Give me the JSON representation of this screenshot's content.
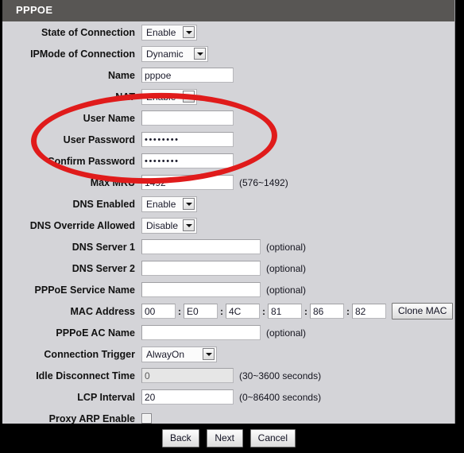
{
  "window": {
    "title": "PPPOE"
  },
  "form": {
    "rows": [
      {
        "label": "State of Connection",
        "type": "select",
        "value": "Enable",
        "hint": ""
      },
      {
        "label": "IPMode of Connection",
        "type": "select",
        "value": "Dynamic",
        "hint": ""
      },
      {
        "label": "Name",
        "type": "text",
        "value": "pppoe",
        "hint": ""
      },
      {
        "label": "NAT",
        "type": "select",
        "value": "Enable",
        "hint": ""
      },
      {
        "label": "User Name",
        "type": "text",
        "value": "",
        "hint": ""
      },
      {
        "label": "User Password",
        "type": "password",
        "value": "••••••••",
        "hint": ""
      },
      {
        "label": "Confirm Password",
        "type": "password",
        "value": "••••••••",
        "hint": ""
      },
      {
        "label": "Max MRU",
        "type": "text",
        "value": "1492",
        "hint": "(576~1492)"
      },
      {
        "label": "DNS Enabled",
        "type": "select",
        "value": "Enable",
        "hint": ""
      },
      {
        "label": "DNS Override Allowed",
        "type": "select",
        "value": "Disable",
        "hint": ""
      },
      {
        "label": "DNS Server 1",
        "type": "text",
        "value": "",
        "hint": "(optional)"
      },
      {
        "label": "DNS Server 2",
        "type": "text",
        "value": "",
        "hint": "(optional)"
      },
      {
        "label": "PPPoE Service Name",
        "type": "text",
        "value": "",
        "hint": "(optional)"
      },
      {
        "label": "MAC Address",
        "type": "mac",
        "value": "",
        "hint": ""
      },
      {
        "label": "PPPoE AC Name",
        "type": "text",
        "value": "",
        "hint": "(optional)"
      },
      {
        "label": "Connection Trigger",
        "type": "select",
        "value": "AlwayOn",
        "hint": ""
      },
      {
        "label": "Idle Disconnect Time",
        "type": "text",
        "value": "0",
        "hint": "(30~3600 seconds)"
      },
      {
        "label": "LCP Interval",
        "type": "text",
        "value": "20",
        "hint": "(0~86400 seconds)"
      },
      {
        "label": "Proxy ARP Enable",
        "type": "checkbox",
        "value": "",
        "hint": ""
      }
    ],
    "labels": {
      "state_of_connection": "State of Connection",
      "ipmode_of_connection": "IPMode of Connection",
      "name": "Name",
      "nat": "NAT",
      "user_name": "User Name",
      "user_password": "User Password",
      "confirm_password": "Confirm Password",
      "max_mru": "Max MRU",
      "dns_enabled": "DNS Enabled",
      "dns_override_allowed": "DNS Override Allowed",
      "dns_server_1": "DNS Server 1",
      "dns_server_2": "DNS Server 2",
      "pppoe_service_name": "PPPoE Service Name",
      "mac_address": "MAC Address",
      "pppoe_ac_name": "PPPoE AC Name",
      "connection_trigger": "Connection Trigger",
      "idle_disconnect_time": "Idle Disconnect Time",
      "lcp_interval": "LCP Interval",
      "proxy_arp_enable": "Proxy ARP Enable"
    },
    "values": {
      "state_of_connection": "Enable",
      "ipmode_of_connection": "Dynamic",
      "name": "pppoe",
      "nat": "Enable",
      "user_name": "",
      "user_password": "••••••••",
      "confirm_password": "••••••••",
      "max_mru": "1492",
      "dns_enabled": "Enable",
      "dns_override_allowed": "Disable",
      "dns_server_1": "",
      "dns_server_2": "",
      "pppoe_service_name": "",
      "pppoe_ac_name": "",
      "connection_trigger": "AlwayOn",
      "idle_disconnect_time": "0",
      "lcp_interval": "20"
    },
    "hints": {
      "max_mru": "(576~1492)",
      "dns_server_1": "(optional)",
      "dns_server_2": "(optional)",
      "pppoe_service_name": "(optional)",
      "pppoe_ac_name": "(optional)",
      "idle_disconnect_time": "(30~3600 seconds)",
      "lcp_interval": "(0~86400 seconds)"
    },
    "mac": {
      "octets": [
        "00",
        "E0",
        "4C",
        "81",
        "86",
        "82"
      ],
      "separator": ":",
      "clone_label": "Clone MAC"
    }
  },
  "footer": {
    "back_label": "Back",
    "next_label": "Next",
    "cancel_label": "Cancel"
  },
  "annotation": {
    "shape": "red-ellipse-highlight",
    "color": "#e01b1b",
    "covers": [
      "User Name",
      "User Password",
      "Confirm Password"
    ]
  }
}
